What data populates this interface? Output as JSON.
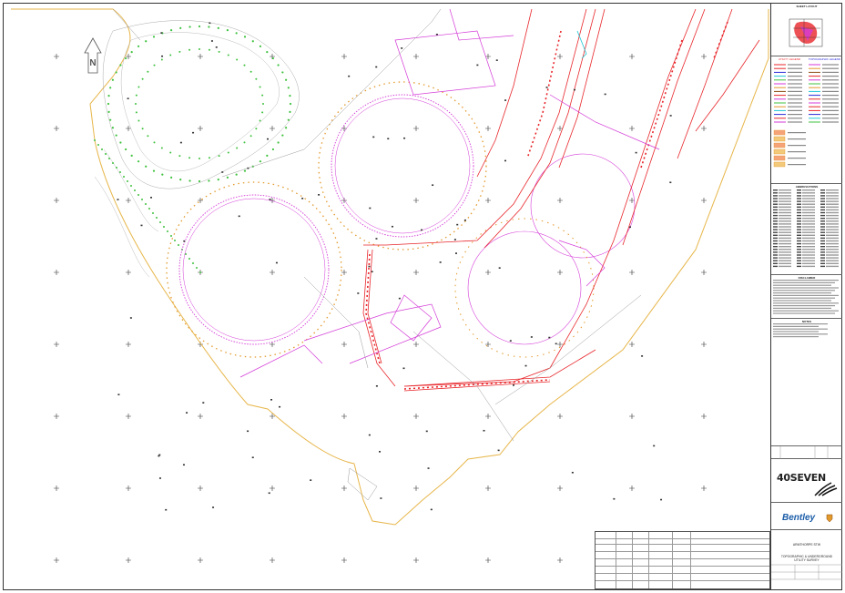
{
  "panel": {
    "key_plan_title": "SHEET LAYOUT",
    "utility_legend_title": "UTILITY LEGEND",
    "topographic_legend_title": "TOPOGRAPHIC LEGEND",
    "abbreviations_title": "ABBREVIATIONS",
    "disclaimer_title": "DISCLAIMER",
    "notes_title": "NOTES",
    "company_logo": "40SEVEN",
    "client_logo": "Bentley",
    "site_name": "ARMTHORPE STW",
    "drawing_title_line1": "TOPOGRAPHIC & UNDERGROUND",
    "drawing_title_line2": "UTILITY SURVEY"
  },
  "colors": {
    "red": "#e8262b",
    "magenta": "#d43ad8",
    "orange": "#e39a2d",
    "green": "#3fc23f",
    "grey": "#9a9a9a",
    "cyan": "#22c7d6",
    "boundary": "#e7b64a"
  },
  "icons": [
    "north-arrow-icon",
    "logo-wave-icon",
    "bentley-badge-icon"
  ]
}
